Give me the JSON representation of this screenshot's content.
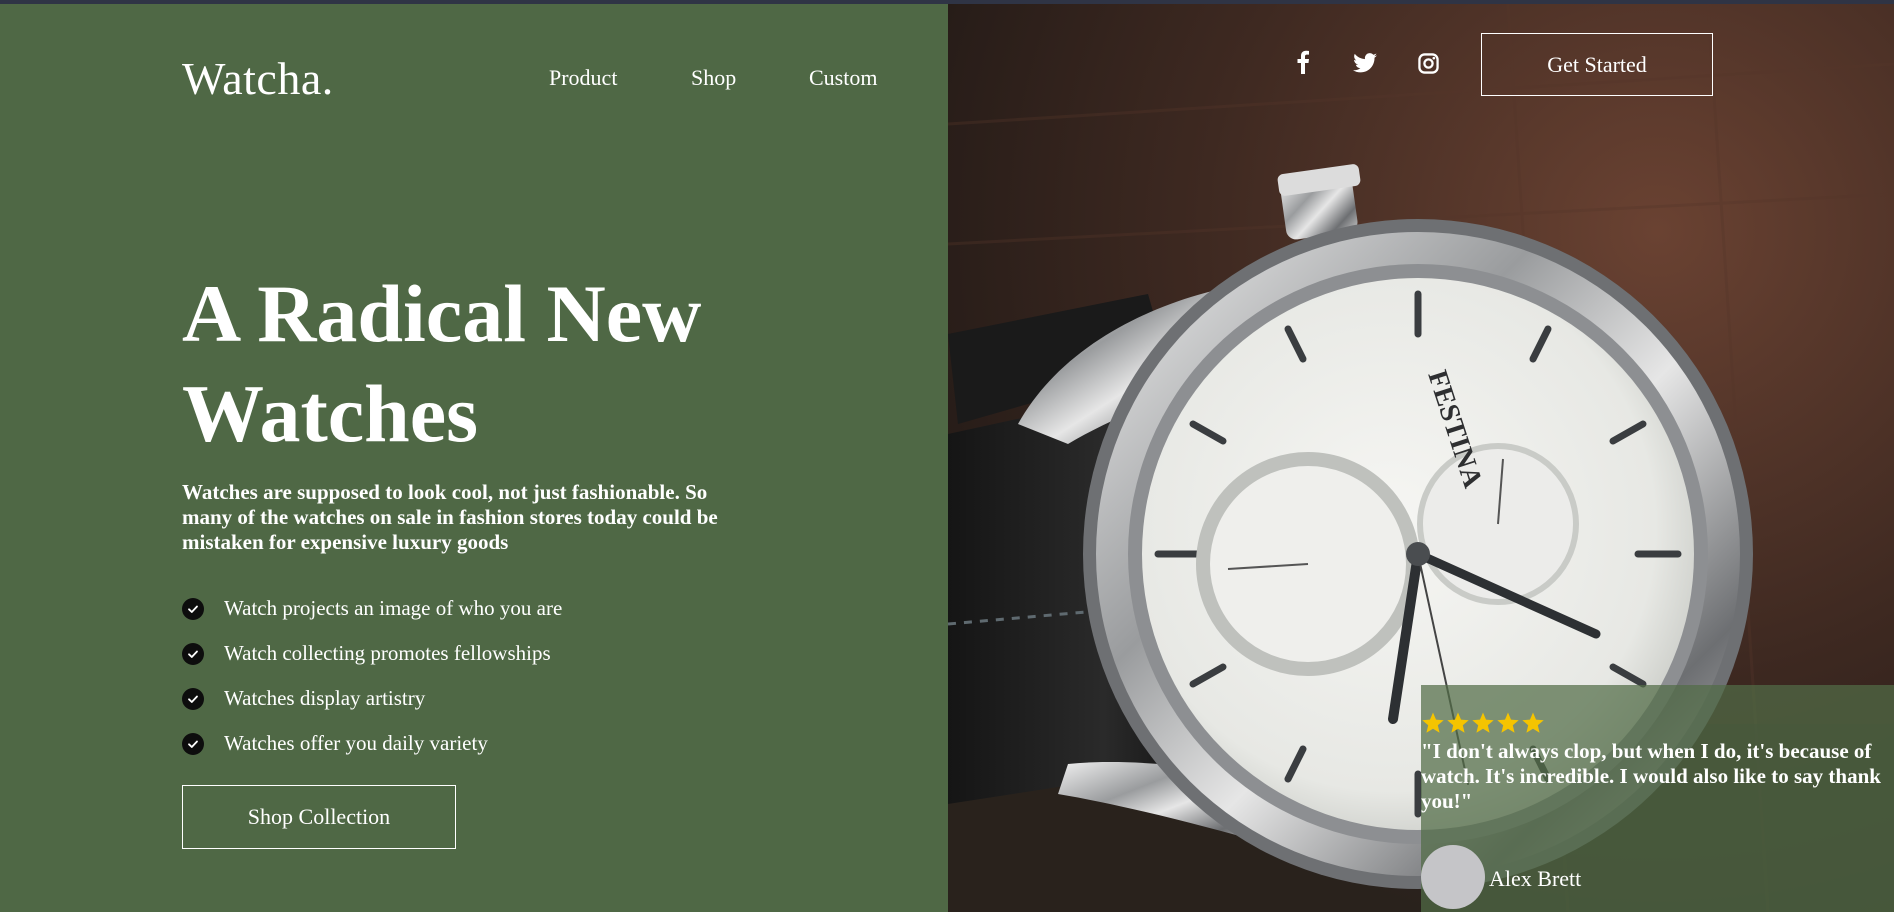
{
  "brand": {
    "logo": "Watcha."
  },
  "nav": {
    "items": [
      "Product",
      "Shop",
      "Custom"
    ]
  },
  "header": {
    "cta_label": "Get Started",
    "social_icons": [
      "facebook-icon",
      "twitter-icon",
      "instagram-icon"
    ]
  },
  "hero": {
    "title_line1": "A Radical New",
    "title_line2": "Watches",
    "subtitle": "Watches are supposed to look cool, not just fashionable. So many of the watches on sale in fashion stores today could be mistaken for expensive luxury goods",
    "features": [
      "Watch projects an image of who you are",
      "Watch collecting promotes fellowships",
      "Watches display artistry",
      "Watches offer you daily variety"
    ],
    "cta_label": "Shop Collection"
  },
  "testimonial": {
    "rating": 5,
    "quote": "\"I don't always clop, but when I do, it's because of watch. It's incredible. I would also like to say thank you!\"",
    "author": "Alex Brett"
  },
  "colors": {
    "panel_green": "#4f6845",
    "text": "#ffffff",
    "star": "#f5c400",
    "check_bg": "#0d0d0d"
  }
}
